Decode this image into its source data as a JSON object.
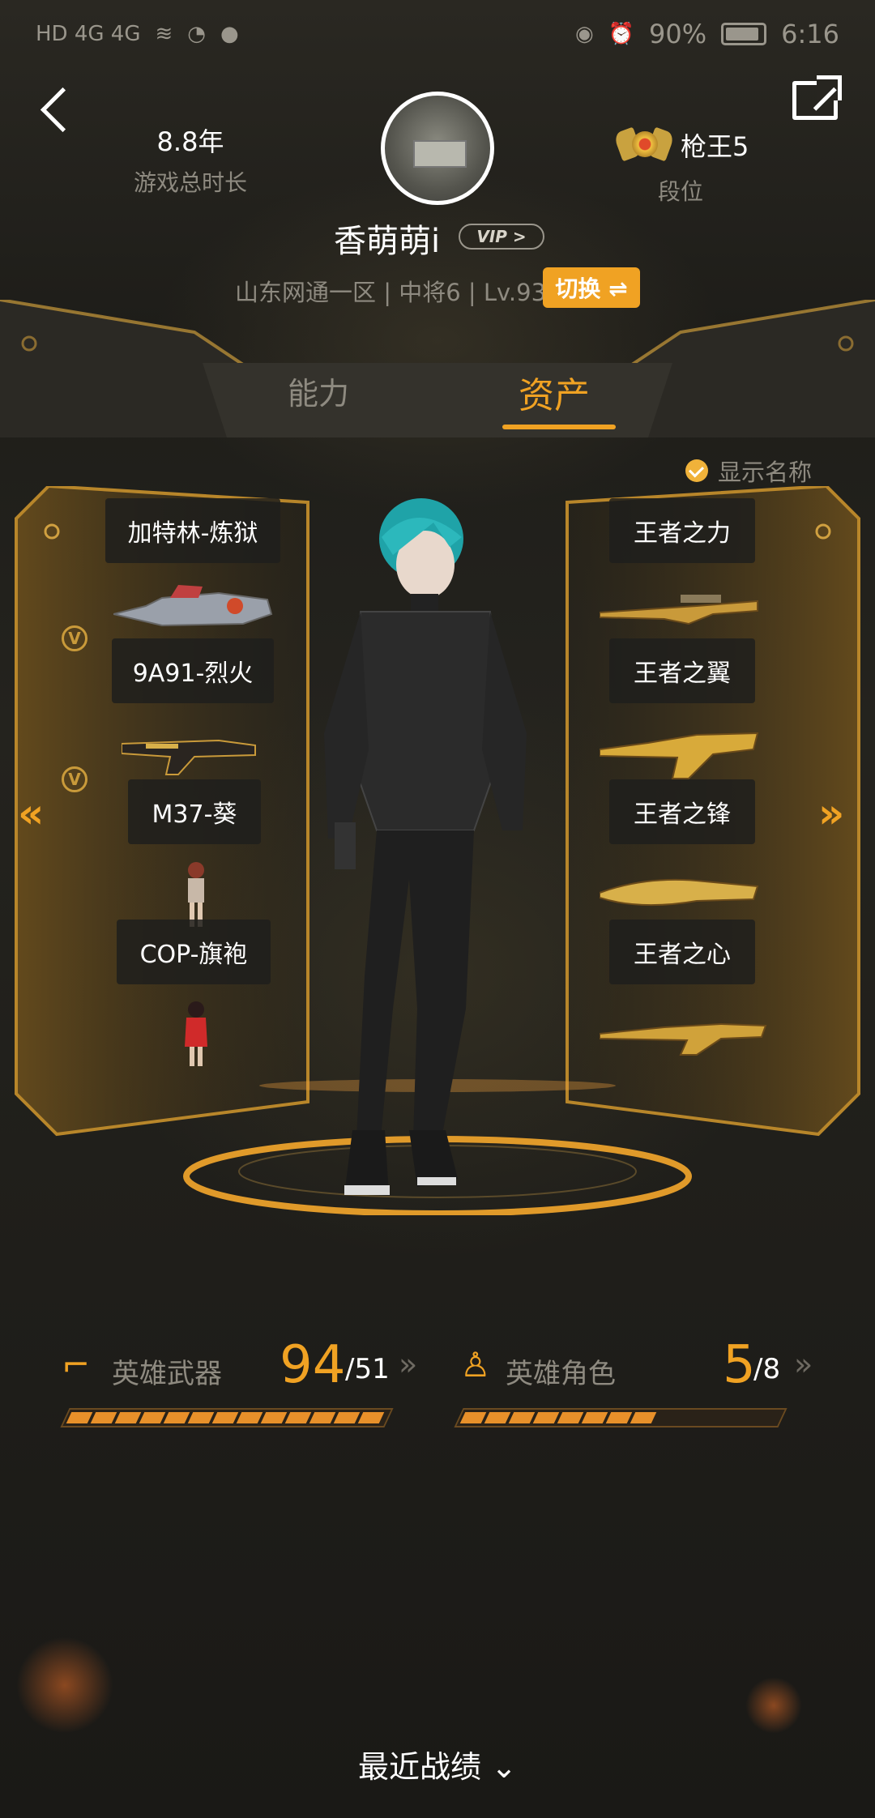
{
  "status_bar": {
    "left": "HD 4G 4G",
    "battery_percent": "90%",
    "time": "6:16"
  },
  "header": {
    "years_value": "8.8年",
    "years_label": "游戏总时长",
    "player_name": "香萌萌i",
    "vip_label": "VIP >",
    "rank_value": "枪王5",
    "rank_label": "段位",
    "server_line": "山东网通一区 | 中将6 | Lv.93",
    "switch_label": "切换 ⇌"
  },
  "tabs": [
    {
      "label": "能力",
      "active": false
    },
    {
      "label": "资产",
      "active": true
    }
  ],
  "show_name_label": "显示名称",
  "left_items": [
    {
      "label": "加特林-炼狱",
      "vip": false
    },
    {
      "label": "9A91-烈火",
      "vip": true
    },
    {
      "label": "M37-葵",
      "vip": true
    },
    {
      "label": "COP-旗袍",
      "vip": false
    }
  ],
  "right_items": [
    {
      "label": "王者之力"
    },
    {
      "label": "王者之翼"
    },
    {
      "label": "王者之锋"
    },
    {
      "label": "王者之心"
    }
  ],
  "vip_mark": "V",
  "stats": {
    "weapons_label": "英雄武器",
    "weapons_value": "94",
    "weapons_total": "/51",
    "weapons_bar_fill": 1.0,
    "roles_label": "英雄角色",
    "roles_value": "5",
    "roles_total": "/8",
    "roles_bar_fill": 0.625
  },
  "recent_label": "最近战绩 ⌄",
  "colors": {
    "accent": "#f0a223",
    "bg": "#1c1b18",
    "muted": "#8e8a80"
  }
}
